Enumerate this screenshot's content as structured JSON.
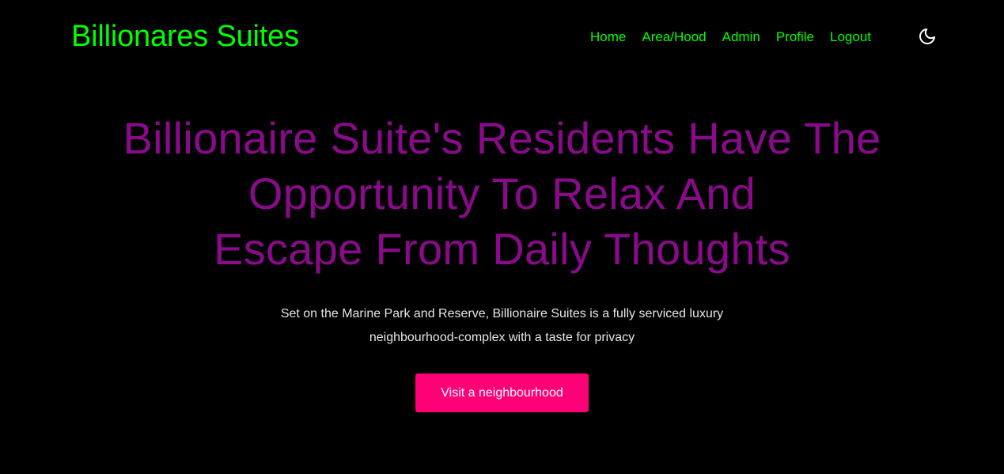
{
  "header": {
    "brand": "Billionares Suites",
    "nav": [
      "Home",
      "Area/Hood",
      "Admin",
      "Profile",
      "Logout"
    ],
    "theme_icon": "moon-icon"
  },
  "hero": {
    "title_lines": [
      "Billionaire Suite's Residents Have The",
      "Opportunity To Relax And",
      "Escape From Daily Thoughts"
    ],
    "subtitle_lines": [
      "Set on the Marine Park and Reserve, Billionaire Suites is a fully serviced luxury",
      "neighbourhood-complex with a taste for privacy"
    ],
    "cta_label": "Visit a neighbourhood"
  },
  "colors": {
    "background": "#000000",
    "brand": "#00ff00",
    "nav": "#00ff00",
    "title": "#8b0a8b",
    "subtitle": "#e6e6e6",
    "cta_bg": "#ff0077",
    "cta_text": "#ffffff"
  }
}
